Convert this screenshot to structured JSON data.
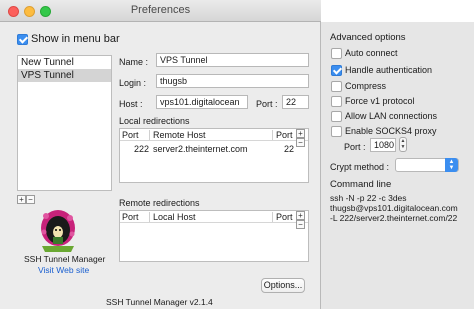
{
  "window": {
    "title": "Preferences"
  },
  "show_in_menu_bar": {
    "label": "Show in menu bar",
    "checked": true
  },
  "tunnels": [
    {
      "label": "New Tunnel",
      "selected": false
    },
    {
      "label": "VPS Tunnel",
      "selected": true
    }
  ],
  "list_controls": {
    "add": "+",
    "remove": "−"
  },
  "form": {
    "name_label": "Name :",
    "name_value": "VPS Tunnel",
    "login_label": "Login :",
    "login_value": "thugsb",
    "host_label": "Host :",
    "host_value": "vps101.digitalocean",
    "port_label": "Port :",
    "port_value": "22"
  },
  "local_redirections": {
    "title": "Local redirections",
    "columns": [
      "Port",
      "Remote Host",
      "Port"
    ],
    "rows": [
      {
        "port": "222",
        "remote_host": "server2.theinternet.com",
        "remote_port": "22"
      }
    ]
  },
  "remote_redirections": {
    "title": "Remote redirections",
    "columns": [
      "Port",
      "Local Host",
      "Port"
    ],
    "rows": []
  },
  "app": {
    "name": "SSH Tunnel Manager",
    "visit_link": "Visit Web site",
    "version": "SSH Tunnel Manager v2.1.4"
  },
  "options_button": "Options...",
  "advanced": {
    "title": "Advanced options",
    "auto_connect": {
      "label": "Auto connect",
      "checked": false
    },
    "handle_auth": {
      "label": "Handle authentication",
      "checked": true
    },
    "compress": {
      "label": "Compress",
      "checked": false
    },
    "force_v1": {
      "label": "Force v1 protocol",
      "checked": false
    },
    "allow_lan": {
      "label": "Allow LAN connections",
      "checked": false
    },
    "socks4": {
      "label": "Enable SOCKS4 proxy",
      "checked": false
    },
    "socks_port_label": "Port :",
    "socks_port_value": "1080",
    "crypt_label": "Crypt method :",
    "crypt_value": "",
    "command_title": "Command line",
    "command_lines": [
      "ssh -N -p 22 -c 3des",
      "thugsb@vps101.digitalocean.com",
      "-L 222/server2.theinternet.com/22"
    ]
  },
  "colors": {
    "accent": "#3b8ef0",
    "link": "#1a5fd0"
  }
}
